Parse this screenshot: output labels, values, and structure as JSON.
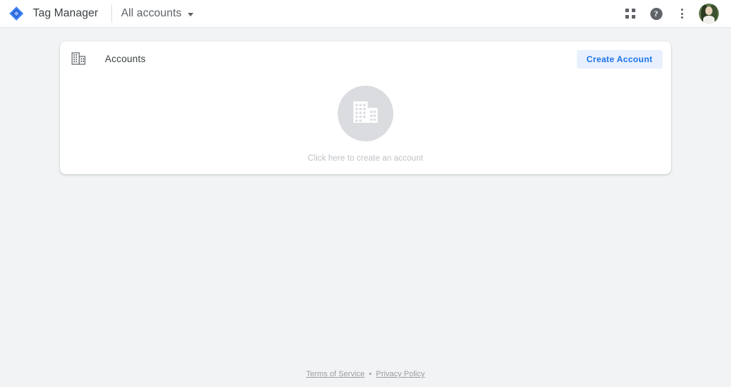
{
  "header": {
    "logo_icon": "tag-manager-diamond-logo",
    "product_name": "Tag Manager",
    "account_selector": {
      "label": "All accounts",
      "caret_icon": "chevron-down-icon"
    },
    "actions": [
      {
        "icon": "apps-grid-icon",
        "label": "Google apps"
      },
      {
        "icon": "help-icon",
        "label": "Help",
        "glyph": "?"
      },
      {
        "icon": "more-vert-icon",
        "label": "More options"
      },
      {
        "icon": "avatar",
        "label": "Account"
      }
    ]
  },
  "card": {
    "icon": "domain-building-icon",
    "title": "Accounts",
    "create_button_label": "Create Account",
    "empty_state": {
      "icon": "building-icon",
      "caption": "Click here to create an account"
    }
  },
  "footer": {
    "terms_label": "Terms of Service",
    "separator": "•",
    "privacy_label": "Privacy Policy"
  },
  "colors": {
    "page_background": "#f1f3f4",
    "card_background": "#ffffff",
    "accent_blue": "#1a73e8",
    "button_background": "#e8f0fe",
    "empty_circle": "#dadce0",
    "muted_text": "#9aa0a6",
    "primary_text": "#3c4043"
  }
}
